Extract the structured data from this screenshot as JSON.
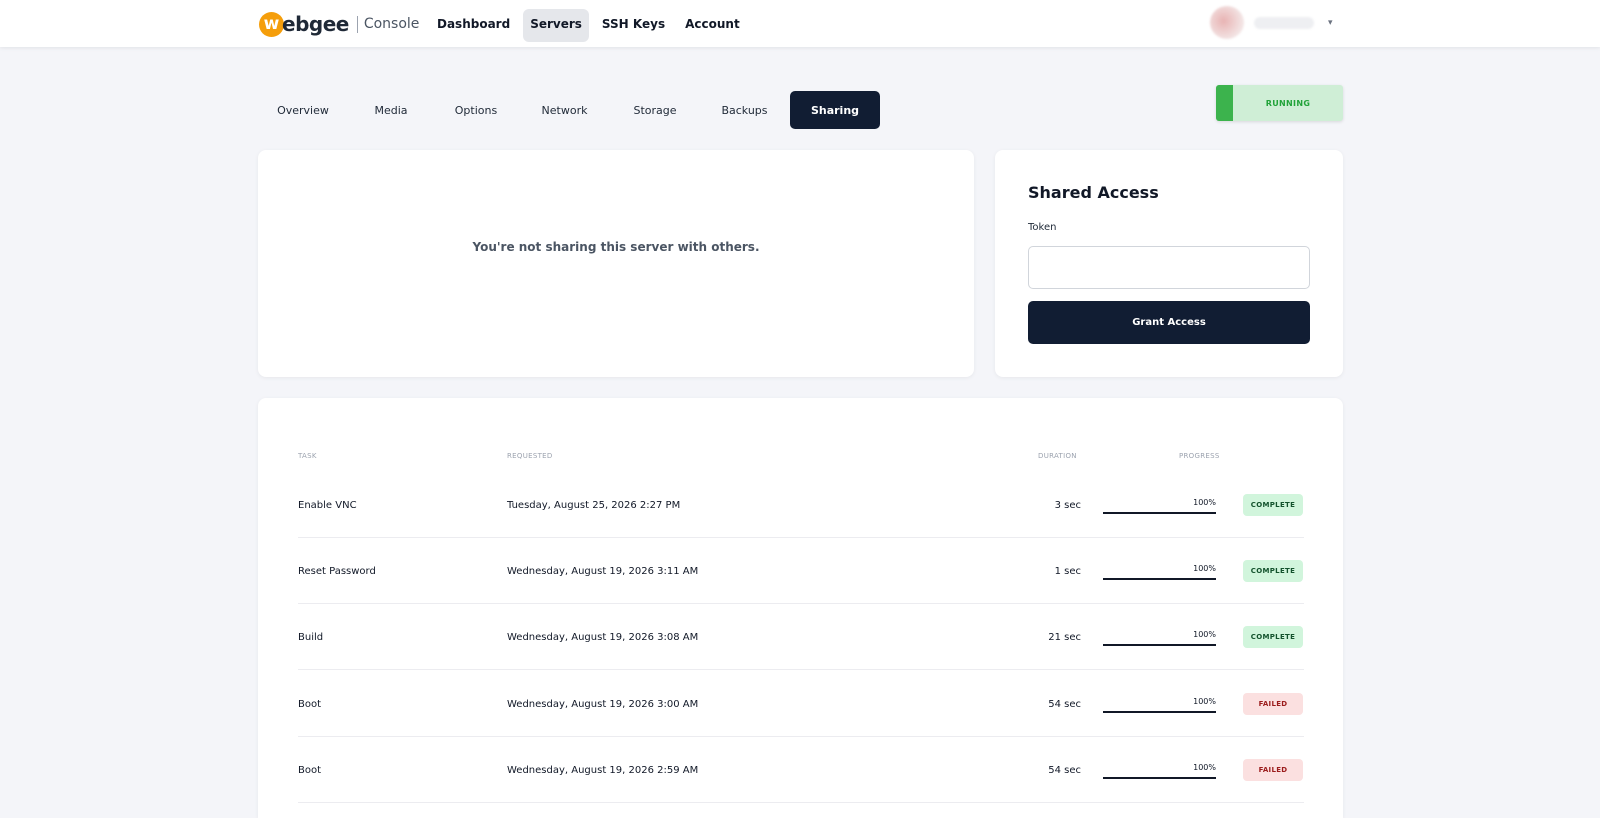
{
  "brand": {
    "logo_letter": "w",
    "name": "ebgee",
    "sub": "Console",
    "accent": "#f59e0b"
  },
  "nav": {
    "items": [
      {
        "label": "Dashboard",
        "active": false
      },
      {
        "label": "Servers",
        "active": true
      },
      {
        "label": "SSH Keys",
        "active": false
      },
      {
        "label": "Account",
        "active": false
      }
    ]
  },
  "user_menu": {
    "chevron": "▾"
  },
  "tabs": [
    {
      "label": "Overview",
      "active": false
    },
    {
      "label": "Media",
      "active": false
    },
    {
      "label": "Options",
      "active": false
    },
    {
      "label": "Network",
      "active": false
    },
    {
      "label": "Storage",
      "active": false
    },
    {
      "label": "Backups",
      "active": false
    },
    {
      "label": "Sharing",
      "active": true
    }
  ],
  "status": {
    "label": "RUNNING",
    "color": "#3cb34d"
  },
  "sharing": {
    "empty_message": "You're not sharing this server with others."
  },
  "shared_access": {
    "title": "Shared Access",
    "token_label": "Token",
    "token_value": "",
    "grant_button": "Grant Access"
  },
  "tasks": {
    "headers": {
      "task": "TASK",
      "requested": "REQUESTED",
      "duration": "DURATION",
      "progress": "PROGRESS"
    },
    "rows": [
      {
        "task": "Enable VNC",
        "requested": "Tuesday, August 25, 2026 2:27 PM",
        "duration": "3 sec",
        "progress": "100%",
        "progress_value": 1.0,
        "status": "COMPLETE",
        "status_kind": "complete"
      },
      {
        "task": "Reset Password",
        "requested": "Wednesday, August 19, 2026 3:11 AM",
        "duration": "1 sec",
        "progress": "100%",
        "progress_value": 1.0,
        "status": "COMPLETE",
        "status_kind": "complete"
      },
      {
        "task": "Build",
        "requested": "Wednesday, August 19, 2026 3:08 AM",
        "duration": "21 sec",
        "progress": "100%",
        "progress_value": 1.0,
        "status": "COMPLETE",
        "status_kind": "complete"
      },
      {
        "task": "Boot",
        "requested": "Wednesday, August 19, 2026 3:00 AM",
        "duration": "54 sec",
        "progress": "100%",
        "progress_value": 1.0,
        "status": "FAILED",
        "status_kind": "failed"
      },
      {
        "task": "Boot",
        "requested": "Wednesday, August 19, 2026 2:59 AM",
        "duration": "54 sec",
        "progress": "100%",
        "progress_value": 1.0,
        "status": "FAILED",
        "status_kind": "failed"
      }
    ]
  }
}
